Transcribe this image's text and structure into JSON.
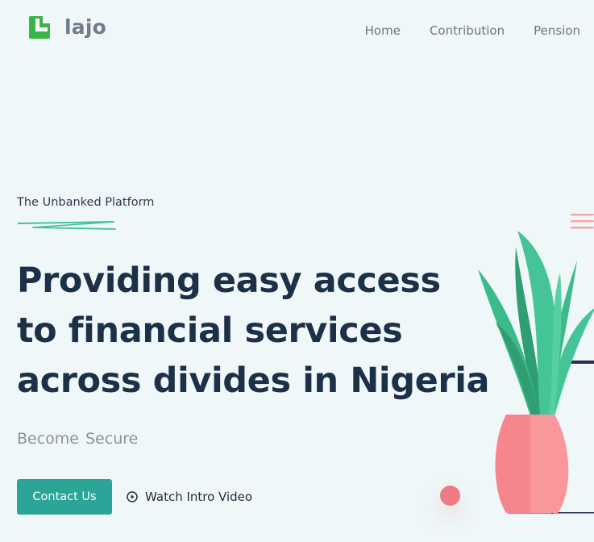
{
  "brand": {
    "name": "lajo",
    "logo_icon": "l-block-logo-icon",
    "logo_color": "#3ab54a"
  },
  "nav": {
    "items": [
      {
        "label": "Home"
      },
      {
        "label": "Contribution"
      },
      {
        "label": "Pension"
      }
    ]
  },
  "hero": {
    "eyebrow": "The Unbanked Platform",
    "headline_lines": [
      "Providing easy access",
      "to financial services",
      "across divides in Nigeria"
    ],
    "rotating_words": [
      "Become",
      "Secure"
    ],
    "primary_button": "Contact Us",
    "secondary_link": "Watch Intro Video",
    "secondary_icon": "play-circle-icon"
  },
  "illustration": {
    "subject": "potted-plant-illustration",
    "pot_color": "#f5868e",
    "leaf_color": "#45c497",
    "menu_icon": "lines-decoration-icon"
  },
  "colors": {
    "background": "#eff7f9",
    "accent": "#2ba598",
    "heading": "#1c3047"
  }
}
